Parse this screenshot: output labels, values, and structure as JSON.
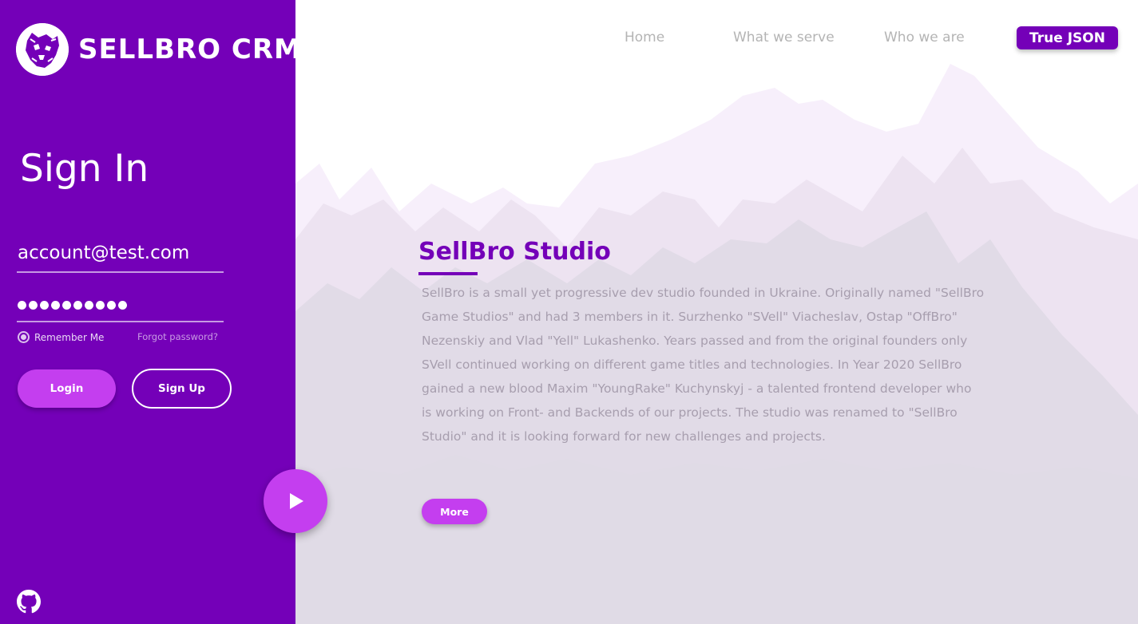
{
  "brand": {
    "name": "SELLBRO CRM",
    "logo_icon": "bear-head-logo"
  },
  "signin": {
    "title": "Sign In",
    "email_value": "account@test.com",
    "password_mask_length": 10,
    "remember_label": "Remember Me",
    "remember_checked": true,
    "forgot_label": "Forgot password?",
    "login_label": "Login",
    "signup_label": "Sign Up",
    "github_icon": "github-icon"
  },
  "nav": {
    "items": [
      {
        "label": "Home"
      },
      {
        "label": "What we serve"
      },
      {
        "label": "Who we are"
      }
    ],
    "cta_label": "True JSON"
  },
  "studio": {
    "title": "SellBro Studio",
    "text": "SellBro is a small yet progressive dev studio founded in Ukraine. Originally named \"SellBro Game Studios\" and had 3 members in it. Surzhenko \"SVell\" Viacheslav, Ostap \"OffBro\" Nezenskiy and Vlad \"Yell\" Lukashenko. Years passed and from the original founders only SVell continued working on different game titles and technologies. In Year 2020 SellBro gained a new blood Maxim \"YoungRake\" Kuchynskyj - a talented frontend developer who is working on Front- and Backends of our projects. The studio was renamed to \"SellBro Studio\" and it is looking forward for new challenges and projects.",
    "more_label": "More"
  },
  "play_icon": "play-icon",
  "colors": {
    "primary": "#7400b8",
    "accent": "#c43eef",
    "text_muted": "#a79eae",
    "nav_text": "#b4b4b4",
    "mountain_light": "#f7effb",
    "mountain_mid": "#ede3f1",
    "mountain_dark": "#e1dbe7"
  }
}
